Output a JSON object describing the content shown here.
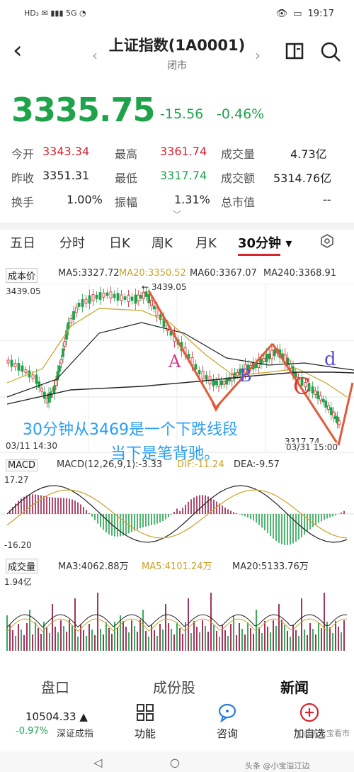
{
  "status": {
    "left_icons": "HD₂  ✉  ▮▮▮ 5G  ◔",
    "time": "19:17",
    "battery": "▭"
  },
  "header": {
    "title": "上证指数(1A0001)",
    "subtitle": "闭市"
  },
  "quote": {
    "price": "3335.75",
    "change": "-15.56",
    "change_pct": "-0.46%"
  },
  "stats": {
    "open_label": "今开",
    "open": "3343.34",
    "high_label": "最高",
    "high": "3361.74",
    "volume_label": "成交量",
    "volume": "4.73亿",
    "prev_label": "昨收",
    "prev": "3351.31",
    "low_label": "最低",
    "low": "3317.74",
    "amount_label": "成交额",
    "amount": "5314.76亿",
    "turnover_label": "换手",
    "turnover": "1.00%",
    "amplitude_label": "振幅",
    "amplitude": "1.31%",
    "mcap_label": "总市值",
    "mcap": "--"
  },
  "tabs": [
    "五日",
    "分时",
    "日K",
    "周K",
    "月K",
    "30分钟 ▾"
  ],
  "main_indicator": {
    "name": "成本价",
    "ma5": "MA5:3327.72",
    "ma20": "MA20:3350.52",
    "ma60": "MA60:3367.07",
    "ma240": "MA240:3368.91",
    "high_label": "3439.05",
    "peak_label": "← 3439.05",
    "low_label": "3317.74",
    "date_left": "03/11 14:30",
    "date_right": "03/31 15:00"
  },
  "macd_indicator": {
    "name": "MACD",
    "params": "MACD(12,26,9,1):-3.33",
    "dif": "DIF:-11.24",
    "dea": "DEA:-9.57",
    "top": "17.27",
    "bottom": "-16.20"
  },
  "volume_indicator": {
    "name": "成交量",
    "ma3": "MA3:4062.88万",
    "ma5": "MA5:4101.24万",
    "ma20": "MA20:5133.76万",
    "top": "1.94亿"
  },
  "annotations": {
    "line1": "30分钟从3469是一个下跌线段",
    "line2": "当下是笔背驰。",
    "label_a": "A",
    "label_b": "B",
    "label_c": "C",
    "label_d": "d"
  },
  "bottom_tabs": [
    "盘口",
    "成份股",
    "新闻"
  ],
  "footer": {
    "index_value": "10504.33 ▲",
    "index_pct": "-0.97%",
    "index_name": "深证成指",
    "btn_function": "功能",
    "btn_consult": "咨询",
    "btn_add": "加自选"
  },
  "watermark": "@陈大宝看市",
  "watermark2": "头条 @小宝溢江边"
}
